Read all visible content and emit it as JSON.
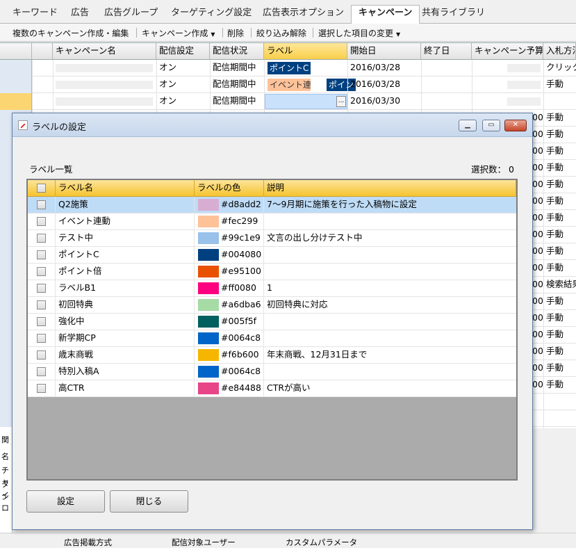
{
  "tabs": [
    "キーワード",
    "広告",
    "広告グループ",
    "ターゲティング設定",
    "広告表示オプション",
    "キャンペーン",
    "共有ライブラリ"
  ],
  "active_tab": "キャンペーン",
  "toolbar": {
    "multi_create": "複数のキャンペーン作成・編集",
    "create": "キャンペーン作成",
    "delete": "削除",
    "clear_filter": "絞り込み解除",
    "change_selected": "選択した項目の変更"
  },
  "grid": {
    "headers": [
      "キャンペーン名",
      "配信設定",
      "配信状況",
      "ラベル",
      "開始日",
      "終了日",
      "キャンペーン予算",
      "入札方法"
    ],
    "rows": [
      {
        "delivery": "オン",
        "status": "配信期間中",
        "labels": [
          {
            "text": "ポイントC",
            "color": "#004080",
            "fg": "#ffffff"
          }
        ],
        "start": "2016/03/28",
        "bid": "クリック"
      },
      {
        "delivery": "オン",
        "status": "配信期間中",
        "labels": [
          {
            "text": "イベント連…",
            "color": "#fec299",
            "fg": "#333333"
          },
          {
            "text": "ポイン",
            "color": "#004080",
            "fg": "#ffffff"
          }
        ],
        "start": "2016/03/28",
        "bid": "手動"
      },
      {
        "delivery": "オン",
        "status": "配信期間中",
        "labels": [],
        "start": "2016/03/30",
        "bid": ""
      }
    ],
    "right_bid": [
      "手動",
      "手動",
      "手動",
      "手動",
      "手動",
      "手動",
      "手動",
      "手動",
      "手動",
      "手動",
      "検索結果",
      "手動",
      "手動",
      "手動",
      "手動",
      "手動",
      "手動"
    ],
    "right_budget_suffix": "00",
    "edit_button": "..."
  },
  "bottom_panel": {
    "labels": [
      "関",
      "名",
      "チャ",
      "タイ",
      "ンロ"
    ]
  },
  "statusbar": [
    "広告掲載方式",
    "配信対象ユーザー",
    "カスタムパラメータ"
  ],
  "dialog": {
    "title": "ラベルの設定",
    "list_title": "ラベル一覧",
    "selected_count_label": "選択数：",
    "selected_count": "0",
    "columns": [
      "ラベル名",
      "ラベルの色",
      "説明"
    ],
    "labels": [
      {
        "name": "Q2施策",
        "color": "#d8add2",
        "desc": "7～9月期に施策を行った入稿物に設定"
      },
      {
        "name": "イベント連動",
        "color": "#fec299",
        "desc": ""
      },
      {
        "name": "テスト中",
        "color": "#99c1e9",
        "desc": "文言の出し分けテスト中"
      },
      {
        "name": "ポイントC",
        "color": "#004080",
        "desc": ""
      },
      {
        "name": "ポイント倍",
        "color": "#e95100",
        "desc": ""
      },
      {
        "name": "ラベルB1",
        "color": "#ff0080",
        "desc": "1"
      },
      {
        "name": "初回特典",
        "color": "#a6dba6",
        "desc": "初回特典に対応"
      },
      {
        "name": "強化中",
        "color": "#005f5f",
        "desc": ""
      },
      {
        "name": "新学期CP",
        "color": "#0064c8",
        "desc": ""
      },
      {
        "name": "歳末商戦",
        "color": "#f6b600",
        "desc": "年末商戦、12月31日まで"
      },
      {
        "name": "特別入稿A",
        "color": "#0064c8",
        "desc": ""
      },
      {
        "name": "高CTR",
        "color": "#e84488",
        "desc": "CTRが高い"
      }
    ],
    "buttons": {
      "apply": "設定",
      "close": "閉じる"
    },
    "window_buttons": {
      "minimize": "▁",
      "restore": "▭",
      "close": "✕"
    }
  },
  "colors": {
    "header_gold": "#f5c430",
    "selection_blue": "#bfdcf7",
    "window_border": "#5f7fa5"
  }
}
